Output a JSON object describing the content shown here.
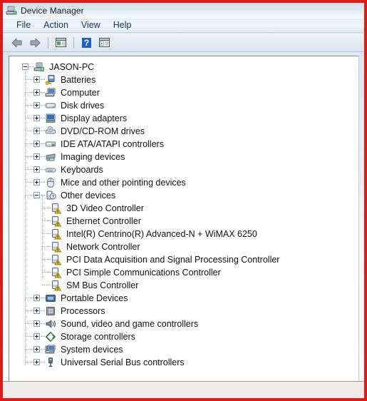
{
  "window": {
    "title": "Device Manager",
    "title_icon": "device-manager-icon",
    "border_color": "#e01b17"
  },
  "menubar": {
    "items": [
      {
        "label": "File",
        "name": "menu-file"
      },
      {
        "label": "Action",
        "name": "menu-action"
      },
      {
        "label": "View",
        "name": "menu-view"
      },
      {
        "label": "Help",
        "name": "menu-help"
      }
    ]
  },
  "toolbar": {
    "buttons": [
      {
        "name": "back-arrow-icon",
        "tooltip": "Back"
      },
      {
        "name": "forward-arrow-icon",
        "tooltip": "Forward"
      },
      {
        "name": "separator-1"
      },
      {
        "name": "properties-icon",
        "tooltip": "Properties"
      },
      {
        "name": "separator-2"
      },
      {
        "name": "help-icon",
        "tooltip": "Help"
      },
      {
        "name": "show-hidden-devices-icon",
        "tooltip": "Show hidden devices"
      }
    ]
  },
  "tree": {
    "root": {
      "label": "JASON-PC",
      "icon": "computer-root-icon",
      "expanded": true
    },
    "nodes": [
      {
        "label": "Batteries",
        "icon": "battery-icon",
        "expanded": false,
        "level": 1
      },
      {
        "label": "Computer",
        "icon": "computer-icon",
        "expanded": false,
        "level": 1
      },
      {
        "label": "Disk drives",
        "icon": "disk-drive-icon",
        "expanded": false,
        "level": 1
      },
      {
        "label": "Display adapters",
        "icon": "display-adapter-icon",
        "expanded": false,
        "level": 1
      },
      {
        "label": "DVD/CD-ROM drives",
        "icon": "dvd-drive-icon",
        "expanded": false,
        "level": 1
      },
      {
        "label": "IDE ATA/ATAPI controllers",
        "icon": "ide-controller-icon",
        "expanded": false,
        "level": 1
      },
      {
        "label": "Imaging devices",
        "icon": "imaging-device-icon",
        "expanded": false,
        "level": 1
      },
      {
        "label": "Keyboards",
        "icon": "keyboard-icon",
        "expanded": false,
        "level": 1
      },
      {
        "label": "Mice and other pointing devices",
        "icon": "mouse-icon",
        "expanded": false,
        "level": 1
      },
      {
        "label": "Other devices",
        "icon": "other-device-icon",
        "expanded": true,
        "level": 1
      },
      {
        "label": "3D Video Controller",
        "icon": "unknown-device-warning-icon",
        "warning": true,
        "level": 2
      },
      {
        "label": "Ethernet Controller",
        "icon": "unknown-device-warning-icon",
        "warning": true,
        "level": 2
      },
      {
        "label": "Intel(R) Centrino(R) Advanced-N + WiMAX 6250",
        "icon": "unknown-device-warning-icon",
        "warning": true,
        "level": 2
      },
      {
        "label": "Network Controller",
        "icon": "unknown-device-warning-icon",
        "warning": true,
        "level": 2
      },
      {
        "label": "PCI Data Acquisition and Signal Processing Controller",
        "icon": "unknown-device-warning-icon",
        "warning": true,
        "level": 2
      },
      {
        "label": "PCI Simple Communications Controller",
        "icon": "unknown-device-warning-icon",
        "warning": true,
        "level": 2
      },
      {
        "label": "SM Bus Controller",
        "icon": "unknown-device-warning-icon",
        "warning": true,
        "level": 2
      },
      {
        "label": "Portable Devices",
        "icon": "portable-device-icon",
        "expanded": false,
        "level": 1
      },
      {
        "label": "Processors",
        "icon": "processor-icon",
        "expanded": false,
        "level": 1
      },
      {
        "label": "Sound, video and game controllers",
        "icon": "sound-controller-icon",
        "expanded": false,
        "level": 1
      },
      {
        "label": "Storage controllers",
        "icon": "storage-controller-icon",
        "expanded": false,
        "level": 1
      },
      {
        "label": "System devices",
        "icon": "system-device-icon",
        "expanded": false,
        "level": 1
      },
      {
        "label": "Universal Serial Bus controllers",
        "icon": "usb-controller-icon",
        "expanded": false,
        "level": 1
      }
    ]
  },
  "statusbar": {
    "text": ""
  }
}
